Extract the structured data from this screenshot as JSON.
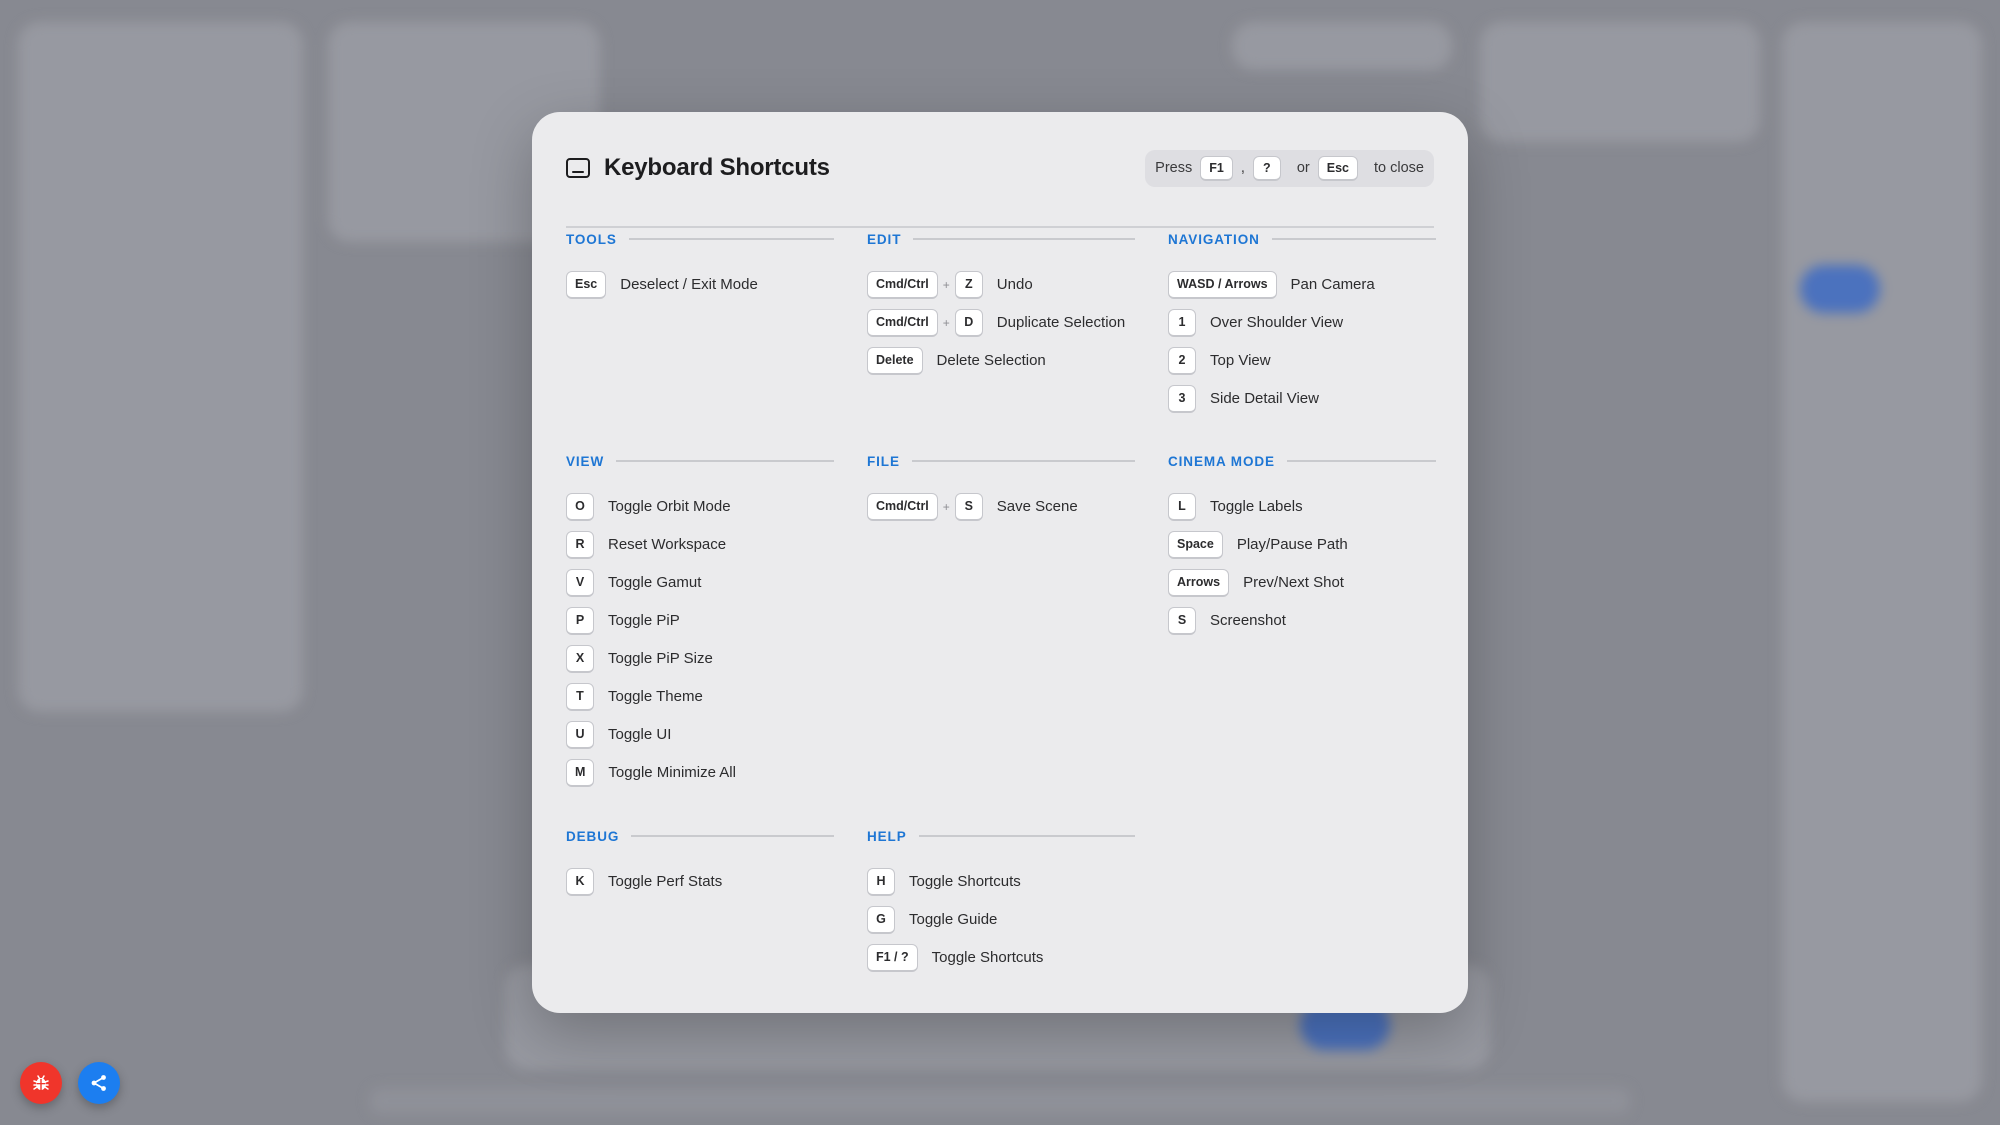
{
  "modal": {
    "title": "Keyboard Shortcuts",
    "close_hint": {
      "press": "Press",
      "key1": "F1",
      "sep": ",",
      "key2": "?",
      "or": "or",
      "key3": "Esc",
      "suffix": "to close"
    }
  },
  "sections": [
    {
      "id": "tools",
      "title": "TOOLS",
      "rows": [
        {
          "keys": [
            "Esc"
          ],
          "desc": "Deselect / Exit Mode"
        }
      ]
    },
    {
      "id": "edit",
      "title": "EDIT",
      "rows": [
        {
          "keys": [
            "Cmd/Ctrl",
            "Z"
          ],
          "desc": "Undo"
        },
        {
          "keys": [
            "Cmd/Ctrl",
            "D"
          ],
          "desc": "Duplicate Selection"
        },
        {
          "keys": [
            "Delete"
          ],
          "desc": "Delete Selection"
        }
      ]
    },
    {
      "id": "navigation",
      "title": "NAVIGATION",
      "rows": [
        {
          "keys": [
            "WASD / Arrows"
          ],
          "desc": "Pan Camera"
        },
        {
          "keys": [
            "1"
          ],
          "desc": "Over Shoulder View"
        },
        {
          "keys": [
            "2"
          ],
          "desc": "Top View"
        },
        {
          "keys": [
            "3"
          ],
          "desc": "Side Detail View"
        }
      ]
    },
    {
      "id": "view",
      "title": "VIEW",
      "rows": [
        {
          "keys": [
            "O"
          ],
          "desc": "Toggle Orbit Mode"
        },
        {
          "keys": [
            "R"
          ],
          "desc": "Reset Workspace"
        },
        {
          "keys": [
            "V"
          ],
          "desc": "Toggle Gamut"
        },
        {
          "keys": [
            "P"
          ],
          "desc": "Toggle PiP"
        },
        {
          "keys": [
            "X"
          ],
          "desc": "Toggle PiP Size"
        },
        {
          "keys": [
            "T"
          ],
          "desc": "Toggle Theme"
        },
        {
          "keys": [
            "U"
          ],
          "desc": "Toggle UI"
        },
        {
          "keys": [
            "M"
          ],
          "desc": "Toggle Minimize All"
        }
      ]
    },
    {
      "id": "file",
      "title": "FILE",
      "rows": [
        {
          "keys": [
            "Cmd/Ctrl",
            "S"
          ],
          "desc": "Save Scene"
        }
      ]
    },
    {
      "id": "cinema-mode",
      "title": "CINEMA MODE",
      "rows": [
        {
          "keys": [
            "L"
          ],
          "desc": "Toggle Labels"
        },
        {
          "keys": [
            "Space"
          ],
          "desc": "Play/Pause Path"
        },
        {
          "keys": [
            "Arrows"
          ],
          "desc": "Prev/Next Shot"
        },
        {
          "keys": [
            "S"
          ],
          "desc": "Screenshot"
        }
      ]
    },
    {
      "id": "debug",
      "title": "DEBUG",
      "rows": [
        {
          "keys": [
            "K"
          ],
          "desc": "Toggle Perf Stats"
        }
      ]
    },
    {
      "id": "help",
      "title": "HELP",
      "rows": [
        {
          "keys": [
            "H"
          ],
          "desc": "Toggle Shortcuts"
        },
        {
          "keys": [
            "G"
          ],
          "desc": "Toggle Guide"
        },
        {
          "keys": [
            "F1 / ?"
          ],
          "desc": "Toggle Shortcuts"
        }
      ]
    }
  ],
  "plus_sign": "+",
  "fabs": {
    "debug_icon": "bug-icon",
    "share_icon": "share-icon"
  },
  "colors": {
    "accent": "#1e76d4",
    "debug": "#f0352b",
    "share": "#1c7ef0"
  }
}
